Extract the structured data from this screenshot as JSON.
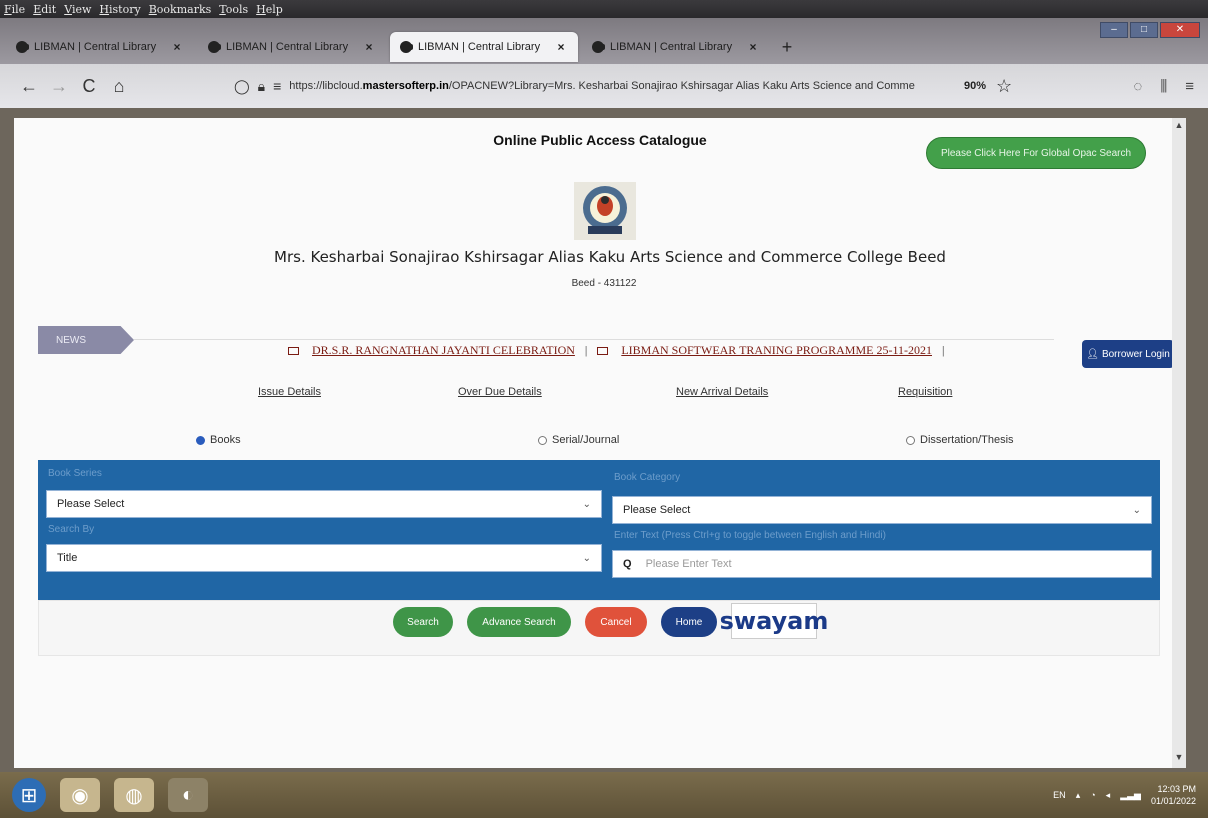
{
  "menubar": {
    "items": [
      "File",
      "Edit",
      "View",
      "History",
      "Bookmarks",
      "Tools",
      "Help"
    ]
  },
  "tabs": [
    {
      "title": "LIBMAN | Central Library",
      "close": "×",
      "active": false
    },
    {
      "title": "LIBMAN | Central Library",
      "close": "×",
      "active": false
    },
    {
      "title": "LIBMAN | Central Library",
      "close": "×",
      "active": true
    },
    {
      "title": "LIBMAN | Central Library",
      "close": "×",
      "active": false
    }
  ],
  "new_tab": "+",
  "navbar": {
    "back": "←",
    "forward": "→",
    "reload": "C",
    "home": "⌂",
    "url_prefix": "https://libcloud.",
    "url_domain": "mastersofterp.in",
    "url_rest": "/OPACNEW?Library=Mrs. Kesharbai Sonajirao Kshirsagar Alias Kaku Arts Science and Comme",
    "zoom": "90%",
    "star": "☆"
  },
  "page": {
    "opac_title": "Online Public Access Catalogue",
    "global_search": "Please Click Here For Global Opac Search",
    "college_name": "Mrs. Kesharbai Sonajirao Kshirsagar Alias Kaku Arts Science and Commerce College Beed",
    "college_address": "Beed - 431122",
    "news_tag": "NEWS",
    "news": [
      "DR.S.R. RANGNATHAN JAYANTI CELEBRATION",
      "LIBMAN SOFTWEAR TRANING PROGRAMME 25-11-2021"
    ],
    "news_sep": "|",
    "borrower_login": "Borrower Login",
    "links": [
      "Issue Details",
      "Over Due Details",
      "New Arrival Details",
      "Requisition"
    ],
    "types": [
      {
        "label": "Books",
        "selected": true
      },
      {
        "label": "Serial/Journal",
        "selected": false
      },
      {
        "label": "Dissertation/Thesis",
        "selected": false
      }
    ],
    "search": {
      "book_series_label": "Book Series",
      "book_series_value": "Please Select",
      "book_category_label": "Book Category",
      "book_category_value": "Please Select",
      "search_by_label": "Search By",
      "search_by_value": "Title",
      "enter_text_label": "Enter Text   (Press Ctrl+g to toggle between English and Hindi)",
      "enter_text_placeholder": "Please Enter Text"
    },
    "buttons": {
      "search": "Search",
      "advance_search": "Advance Search",
      "cancel": "Cancel",
      "home": "Home",
      "swayam": "swayam"
    }
  },
  "taskbar": {
    "lang": "EN",
    "time": "12:03 PM",
    "date": "01/01/2022"
  },
  "colors": {
    "panel_blue": "#2066a5",
    "green": "#43a04a",
    "red": "#e0523b",
    "navy": "#1d3f86",
    "news_link": "#7a1b12"
  }
}
